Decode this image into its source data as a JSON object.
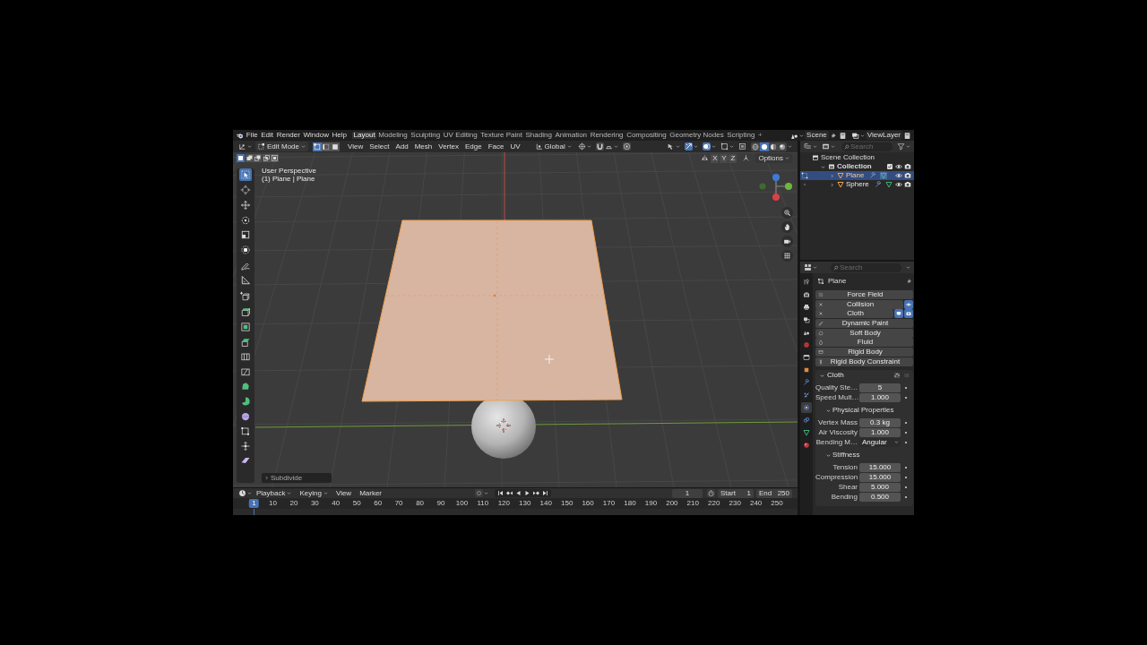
{
  "topbar": {
    "menus": [
      "File",
      "Edit",
      "Render",
      "Window",
      "Help"
    ],
    "workspaces": [
      {
        "label": "Layout",
        "selected": true
      },
      {
        "label": "Modeling",
        "selected": false
      },
      {
        "label": "Sculpting",
        "selected": false
      },
      {
        "label": "UV Editing",
        "selected": false
      },
      {
        "label": "Texture Paint",
        "selected": false
      },
      {
        "label": "Shading",
        "selected": false
      },
      {
        "label": "Animation",
        "selected": false
      },
      {
        "label": "Rendering",
        "selected": false
      },
      {
        "label": "Compositing",
        "selected": false
      },
      {
        "label": "Geometry Nodes",
        "selected": false
      },
      {
        "label": "Scripting",
        "selected": false
      }
    ],
    "add_workspace": "+",
    "scene": "Scene",
    "view_layer": "ViewLayer"
  },
  "viewport_header": {
    "mode": "Edit Mode",
    "select_modes": [
      {
        "kind": "vertex",
        "selected": true
      },
      {
        "kind": "edge",
        "selected": false
      },
      {
        "kind": "face",
        "selected": false
      }
    ],
    "menus": [
      "View",
      "Select",
      "Add",
      "Mesh",
      "Vertex",
      "Edge",
      "Face",
      "UV"
    ],
    "orientation": "Global",
    "gizmos_on": true,
    "overlays_on": true,
    "shading": [
      {
        "kind": "wireframe",
        "selected": false
      },
      {
        "kind": "solid",
        "selected": true
      },
      {
        "kind": "material",
        "selected": false
      },
      {
        "kind": "rendered",
        "selected": false
      }
    ]
  },
  "tool_settings": {
    "select_box_modes": [
      {
        "kind": "set",
        "selected": true
      },
      {
        "kind": "extend",
        "selected": false
      },
      {
        "kind": "subtract",
        "selected": false
      },
      {
        "kind": "invert",
        "selected": false
      },
      {
        "kind": "intersect",
        "selected": false
      }
    ],
    "mirror_axes": [
      {
        "label": "X",
        "on": false
      },
      {
        "label": "Y",
        "on": false
      },
      {
        "label": "Z",
        "on": false
      }
    ],
    "options": "Options"
  },
  "toolbar": {
    "groups": [
      {
        "tools": [
          {
            "kind": "select_box",
            "selected": true
          },
          {
            "kind": "cursor",
            "selected": false
          }
        ]
      },
      {
        "tools": [
          {
            "kind": "move",
            "selected": false
          },
          {
            "kind": "rotate",
            "selected": false
          },
          {
            "kind": "scale",
            "selected": false
          },
          {
            "kind": "transform",
            "selected": false
          }
        ]
      },
      {
        "tools": [
          {
            "kind": "annotate",
            "selected": false
          },
          {
            "kind": "measure",
            "selected": false
          }
        ]
      },
      {
        "tools": [
          {
            "kind": "add_cube",
            "selected": false
          }
        ]
      },
      {
        "tools": [
          {
            "kind": "extrude",
            "selected": false
          },
          {
            "kind": "inset",
            "selected": false
          },
          {
            "kind": "bevel",
            "selected": false
          },
          {
            "kind": "loop_cut",
            "selected": false
          },
          {
            "kind": "knife",
            "selected": false
          },
          {
            "kind": "poly_build",
            "selected": false
          },
          {
            "kind": "spin",
            "selected": false
          },
          {
            "kind": "smooth",
            "selected": false
          },
          {
            "kind": "edge_slide",
            "selected": false
          },
          {
            "kind": "shrink_fatten",
            "selected": false
          },
          {
            "kind": "shear",
            "selected": false
          }
        ]
      }
    ]
  },
  "viewport": {
    "view_name": "User Perspective",
    "object_info": "(1) Plane | Plane",
    "last_operator": "Subdivide"
  },
  "outliner": {
    "search_placeholder": "Search",
    "tree": [
      {
        "label": "Scene Collection",
        "kind": "scene_collection",
        "children": [
          {
            "label": "Collection",
            "kind": "collection",
            "expanded": true,
            "children": [
              {
                "label": "Plane",
                "kind": "mesh_object",
                "selected": true,
                "expanded": false,
                "in_edit_mode": true
              },
              {
                "label": "Sphere",
                "kind": "mesh_object",
                "selected": false,
                "expanded": false,
                "in_edit_mode": false
              }
            ]
          }
        ]
      }
    ]
  },
  "properties": {
    "search_placeholder": "Search",
    "tabs": [
      {
        "kind": "tool",
        "selected": false
      },
      {
        "kind": "render",
        "selected": false
      },
      {
        "kind": "output",
        "selected": false
      },
      {
        "kind": "view_layer",
        "selected": false
      },
      {
        "kind": "scene",
        "selected": false
      },
      {
        "kind": "world",
        "selected": false
      },
      {
        "kind": "collection",
        "selected": false
      },
      {
        "kind": "object",
        "selected": false
      },
      {
        "kind": "modifiers",
        "selected": false
      },
      {
        "kind": "particles",
        "selected": false
      },
      {
        "kind": "physics",
        "selected": true
      },
      {
        "kind": "constraints",
        "selected": false
      },
      {
        "kind": "data",
        "selected": false
      },
      {
        "kind": "material",
        "selected": false
      }
    ],
    "object_name": "Plane",
    "physics": [
      {
        "label": "Force Field",
        "kind": "force_field",
        "enabled": false
      },
      {
        "label": "Collision",
        "enabled": true,
        "toggles": [
          {
            "kind": "eye",
            "on": true
          }
        ]
      },
      {
        "label": "Cloth",
        "enabled": true,
        "toggles": [
          {
            "kind": "monitor",
            "on": true
          },
          {
            "kind": "camera",
            "on": true
          }
        ]
      },
      {
        "label": "Dynamic Paint",
        "kind": "dynamic_paint",
        "enabled": false
      },
      {
        "label": "Soft Body",
        "kind": "soft_body",
        "enabled": false
      },
      {
        "label": "Fluid",
        "kind": "fluid",
        "enabled": false
      },
      {
        "label": "Rigid Body",
        "kind": "rigid_body",
        "enabled": false
      },
      {
        "label": "Rigid Body Constraint",
        "kind": "rigid_body_constraint",
        "enabled": false
      }
    ],
    "panel": {
      "title": "Cloth",
      "expanded": true,
      "fields": [
        {
          "label": "Quality Ste…",
          "value": "5",
          "kind": "number"
        },
        {
          "label": "Speed Mult…",
          "value": "1.000",
          "kind": "number"
        }
      ],
      "subpanels": [
        {
          "title": "Physical Properties",
          "expanded": true,
          "fields": [
            {
              "label": "Vertex Mass",
              "value": "0.3 kg",
              "kind": "number"
            },
            {
              "label": "Air Viscosity",
              "value": "1.000",
              "kind": "number"
            },
            {
              "label": "Bending M…",
              "value": "Angular",
              "kind": "dropdown"
            }
          ]
        },
        {
          "title": "Stiffness",
          "expanded": true,
          "fields": [
            {
              "label": "Tension",
              "value": "15.000",
              "kind": "number"
            },
            {
              "label": "Compression",
              "value": "15.000",
              "kind": "number"
            },
            {
              "label": "Shear",
              "value": "5.000",
              "kind": "number"
            },
            {
              "label": "Bending",
              "value": "0.500",
              "kind": "number"
            }
          ]
        }
      ]
    }
  },
  "timeline": {
    "menus": [
      {
        "label": "Playback",
        "dropdown": true
      },
      {
        "label": "Keying",
        "dropdown": true
      },
      {
        "label": "View",
        "dropdown": false
      },
      {
        "label": "Marker",
        "dropdown": false
      }
    ],
    "current_frame": "1",
    "start_label": "Start",
    "start": "1",
    "end_label": "End",
    "end": "250",
    "ruler": [
      {
        "label": "1",
        "selected": true
      },
      {
        "label": "10",
        "selected": false
      },
      {
        "label": "20",
        "selected": false
      },
      {
        "label": "30",
        "selected": false
      },
      {
        "label": "40",
        "selected": false
      },
      {
        "label": "50",
        "selected": false
      },
      {
        "label": "60",
        "selected": false
      },
      {
        "label": "70",
        "selected": false
      },
      {
        "label": "80",
        "selected": false
      },
      {
        "label": "90",
        "selected": false
      },
      {
        "label": "100",
        "selected": false
      },
      {
        "label": "110",
        "selected": false
      },
      {
        "label": "120",
        "selected": false
      },
      {
        "label": "130",
        "selected": false
      },
      {
        "label": "140",
        "selected": false
      },
      {
        "label": "150",
        "selected": false
      },
      {
        "label": "160",
        "selected": false
      },
      {
        "label": "170",
        "selected": false
      },
      {
        "label": "180",
        "selected": false
      },
      {
        "label": "190",
        "selected": false
      },
      {
        "label": "200",
        "selected": false
      },
      {
        "label": "210",
        "selected": false
      },
      {
        "label": "220",
        "selected": false
      },
      {
        "label": "230",
        "selected": false
      },
      {
        "label": "240",
        "selected": false
      },
      {
        "label": "250",
        "selected": false
      }
    ]
  }
}
